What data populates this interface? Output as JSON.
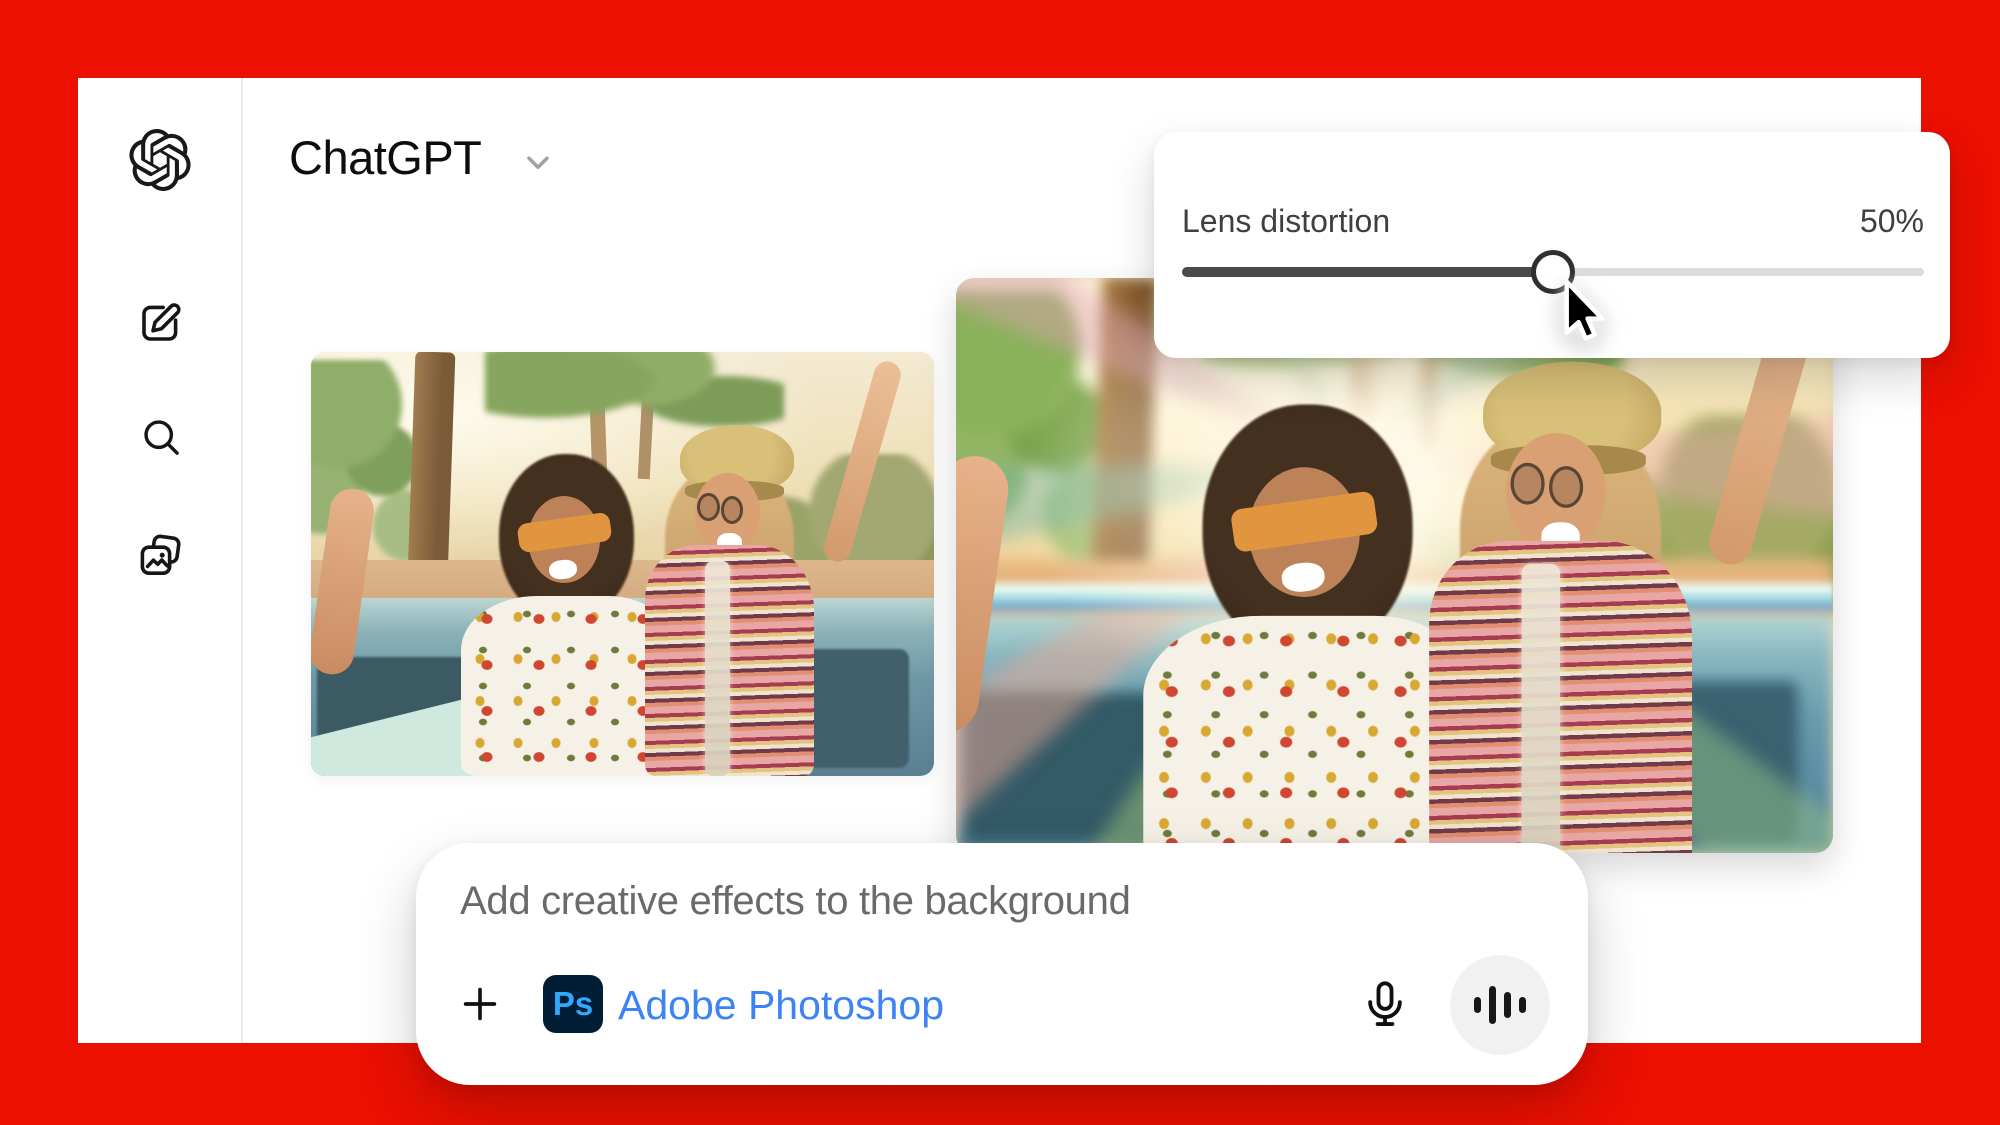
{
  "header": {
    "title": "ChatGPT",
    "chevron_icon": "chevron-down"
  },
  "sidebar": {
    "icons": [
      {
        "name": "openai-logo"
      },
      {
        "name": "new-chat"
      },
      {
        "name": "search"
      },
      {
        "name": "image-library"
      }
    ]
  },
  "lens_panel": {
    "label": "Lens distortion",
    "value": 50,
    "value_label": "50%",
    "min": 0,
    "max": 100
  },
  "composer": {
    "prompt": "Add creative effects to the background",
    "plugin": {
      "badge": "Ps",
      "name": "Adobe Photoshop"
    },
    "icons": [
      "plus",
      "microphone",
      "voice-mode"
    ]
  },
  "photos": {
    "original": {
      "alt": "Two friends laughing in a convertible in the desert with palm trees"
    },
    "distorted": {
      "alt": "Same photo with radial zoom lens-distortion blur applied to the background"
    }
  },
  "colors": {
    "frame_red": "#eb1000",
    "title": "#0d0d0d",
    "chevron": "#a2a2a2",
    "divider": "#ececec",
    "panel_text": "#3f3f3f",
    "slider_fill": "#4b4b4b",
    "slider_track": "#dcdcdc",
    "handle_ring": "#2f2f2f",
    "prompt_text": "#6a6a6a",
    "adobe_blue": "#3c83f6",
    "ps_badge_bg": "#001e36",
    "ps_badge_text": "#31a8ff",
    "voice_circle": "#f1f1f2",
    "icon": "#161616"
  }
}
